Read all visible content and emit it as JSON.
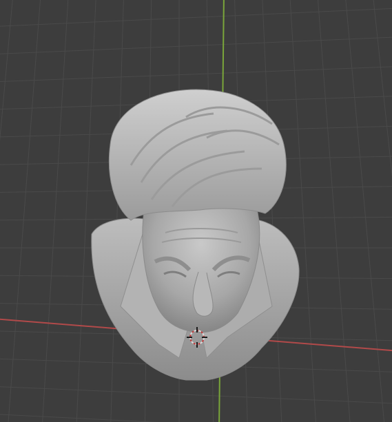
{
  "app": {
    "name": "",
    "view": "3D Viewport"
  },
  "viewport": {
    "background": "#3d3d3d",
    "grid_color": "#4a4a4a",
    "x_axis_color": "#b24a4a",
    "y_axis_color": "#7aa63a"
  },
  "scene": {
    "object": "sculpted-head-bust",
    "cursor": "3d-cursor-icon"
  }
}
